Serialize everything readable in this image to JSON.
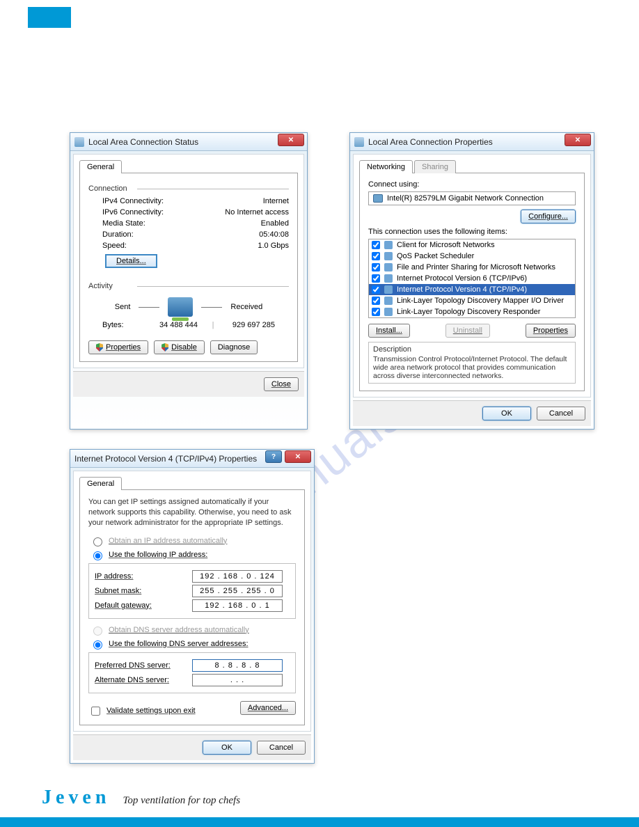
{
  "brand": {
    "name": "Jeven",
    "tagline": "Top ventilation for top chefs"
  },
  "watermark": "manualshive.com",
  "d1": {
    "title": "Local Area Connection Status",
    "tab_general": "General",
    "group_connection": "Connection",
    "ipv4_label": "IPv4 Connectivity:",
    "ipv4_value": "Internet",
    "ipv6_label": "IPv6 Connectivity:",
    "ipv6_value": "No Internet access",
    "media_label": "Media State:",
    "media_value": "Enabled",
    "duration_label": "Duration:",
    "duration_value": "05:40:08",
    "speed_label": "Speed:",
    "speed_value": "1.0 Gbps",
    "details_btn": "Details...",
    "group_activity": "Activity",
    "sent": "Sent",
    "received": "Received",
    "bytes_label": "Bytes:",
    "bytes_sent": "34 488 444",
    "bytes_recv": "929 697 285",
    "properties_btn": "Properties",
    "disable_btn": "Disable",
    "diagnose_btn": "Diagnose",
    "close_btn": "Close"
  },
  "d2": {
    "title": "Local Area Connection Properties",
    "tab_networking": "Networking",
    "tab_sharing": "Sharing",
    "connect_using": "Connect using:",
    "adapter": "Intel(R) 82579LM Gigabit Network Connection",
    "configure_btn": "Configure...",
    "items_label": "This connection uses the following items:",
    "items": [
      "Client for Microsoft Networks",
      "QoS Packet Scheduler",
      "File and Printer Sharing for Microsoft Networks",
      "Internet Protocol Version 6 (TCP/IPv6)",
      "Internet Protocol Version 4 (TCP/IPv4)",
      "Link-Layer Topology Discovery Mapper I/O Driver",
      "Link-Layer Topology Discovery Responder"
    ],
    "install_btn": "Install...",
    "uninstall_btn": "Uninstall",
    "properties_btn": "Properties",
    "desc_label": "Description",
    "desc_text": "Transmission Control Protocol/Internet Protocol. The default wide area network protocol that provides communication across diverse interconnected networks.",
    "ok_btn": "OK",
    "cancel_btn": "Cancel"
  },
  "d3": {
    "title": "Internet Protocol Version 4 (TCP/IPv4) Properties",
    "tab_general": "General",
    "help_text": "You can get IP settings assigned automatically if your network supports this capability. Otherwise, you need to ask your network administrator for the appropriate IP settings.",
    "r_auto_ip": "Obtain an IP address automatically",
    "r_use_ip": "Use the following IP address:",
    "ip_label": "IP address:",
    "ip_value": "192 . 168 .   0   . 124",
    "mask_label": "Subnet mask:",
    "mask_value": "255 . 255 . 255 .   0",
    "gw_label": "Default gateway:",
    "gw_value": "192 . 168 .   0   .   1",
    "r_auto_dns": "Obtain DNS server address automatically",
    "r_use_dns": "Use the following DNS server addresses:",
    "pdns_label": "Preferred DNS server:",
    "pdns_value": "8   .   8   .   8   .   8",
    "adns_label": "Alternate DNS server:",
    "adns_value": ".       .       .",
    "validate": "Validate settings upon exit",
    "advanced_btn": "Advanced...",
    "ok_btn": "OK",
    "cancel_btn": "Cancel"
  }
}
